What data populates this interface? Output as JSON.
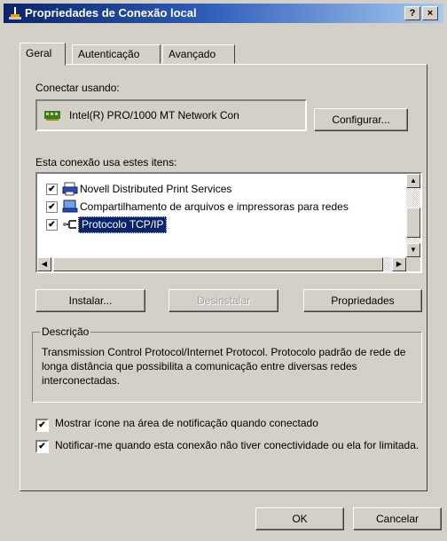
{
  "window": {
    "title": "Propriedades de Conexão local",
    "help_button": "?",
    "close_button": "×"
  },
  "tabs": [
    {
      "label": "Geral",
      "active": true
    },
    {
      "label": "Autenticação",
      "active": false
    },
    {
      "label": "Avançado",
      "active": false
    }
  ],
  "connect_using": {
    "label": "Conectar usando:",
    "adapter_name": "Intel(R) PRO/1000 MT Network Con",
    "configure_button": "Configurar..."
  },
  "items_section": {
    "label": "Esta conexão usa estes itens:",
    "items": [
      {
        "label": "Novell Distributed Print Services",
        "checked": true,
        "icon": "printer-icon",
        "selected": false
      },
      {
        "label": "Compartilhamento de arquivos e impressoras para redes",
        "checked": true,
        "icon": "share-icon",
        "selected": false
      },
      {
        "label": "Protocolo TCP/IP",
        "checked": true,
        "icon": "protocol-icon",
        "selected": true
      }
    ]
  },
  "item_buttons": {
    "install": "Instalar...",
    "uninstall": "Desinstalar",
    "properties": "Propriedades"
  },
  "description": {
    "title": "Descrição",
    "text": "Transmission Control Protocol/Internet Protocol. Protocolo padrão de rede de longa distância que possibilita a comunicação entre diversas redes interconectadas."
  },
  "options": {
    "show_icon": {
      "label": "Mostrar ícone na área de notificação quando conectado",
      "checked": true
    },
    "notify": {
      "label": "Notificar-me quando esta conexão não tiver conectividade ou ela for limitada.",
      "checked": true
    }
  },
  "footer": {
    "ok": "OK",
    "cancel": "Cancelar"
  },
  "colors": {
    "face": "#d4d0c8",
    "selection": "#0a246a",
    "title_start": "#0a246a",
    "title_end": "#a6caf0"
  }
}
